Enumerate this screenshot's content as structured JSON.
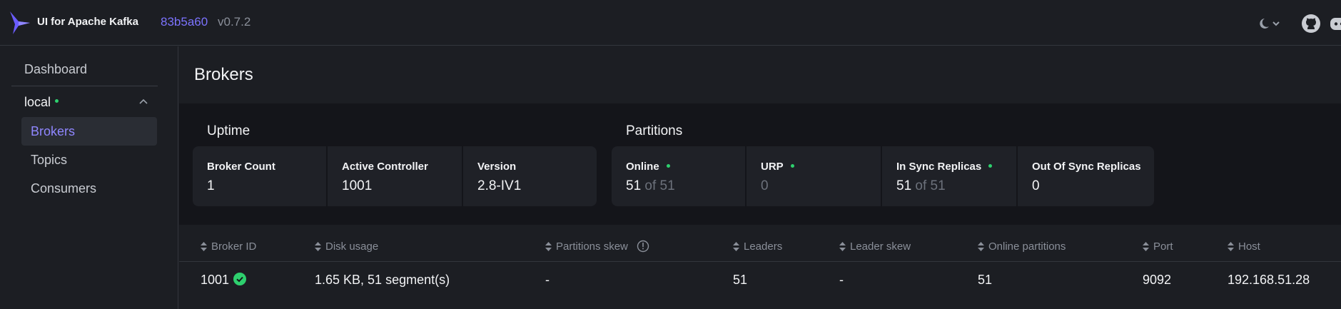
{
  "app": {
    "title": "UI for Apache Kafka",
    "commit": "83b5a60",
    "version": "v0.7.2"
  },
  "icons": {
    "logo": "kafka-ui-logo",
    "theme": "moon-icon",
    "theme_menu": "chevron-down-icon",
    "github": "github-icon",
    "discord": "discord-icon"
  },
  "sidebar": {
    "dashboard_label": "Dashboard",
    "cluster_name": "local",
    "cluster_status_color": "#2ed06e",
    "items": [
      {
        "label": "Brokers",
        "active": true
      },
      {
        "label": "Topics",
        "active": false
      },
      {
        "label": "Consumers",
        "active": false
      }
    ]
  },
  "page": {
    "title": "Brokers"
  },
  "uptime": {
    "title": "Uptime",
    "cards": [
      {
        "label": "Broker Count",
        "value": "1"
      },
      {
        "label": "Active Controller",
        "value": "1001"
      },
      {
        "label": "Version",
        "value": "2.8-IV1"
      }
    ]
  },
  "partitions": {
    "title": "Partitions",
    "online": {
      "label": "Online",
      "value": "51",
      "total": "of 51"
    },
    "urp": {
      "label": "URP",
      "value": "0"
    },
    "in_sync": {
      "label": "In Sync Replicas",
      "value": "51",
      "total": "of 51"
    },
    "out_of_sync": {
      "label": "Out Of Sync Replicas",
      "value": "0"
    }
  },
  "table": {
    "columns": [
      "Broker ID",
      "Disk usage",
      "Partitions skew",
      "Leaders",
      "Leader skew",
      "Online partitions",
      "Port",
      "Host"
    ],
    "rows": [
      {
        "broker_id": "1001",
        "disk_usage": "1.65 KB, 51 segment(s)",
        "partitions_skew": "-",
        "leaders": "51",
        "leader_skew": "-",
        "online_partitions": "51",
        "port": "9092",
        "host": "192.168.51.28"
      }
    ]
  },
  "colors": {
    "accent": "#7c73ff",
    "status_ok": "#2ed06e",
    "background": "#1c1e23"
  }
}
